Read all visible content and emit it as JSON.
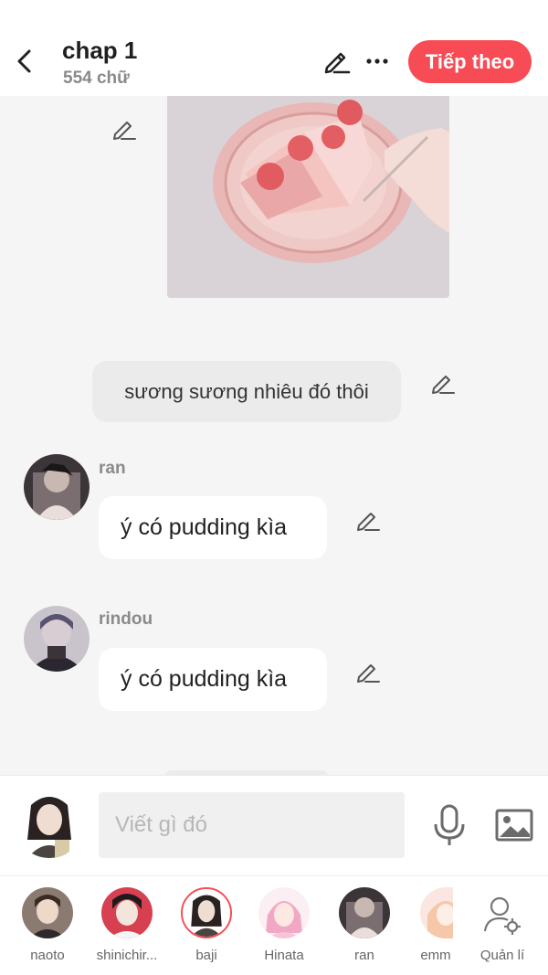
{
  "header": {
    "title": "chap 1",
    "word_count": "554 chữ",
    "next_label": "Tiếp theo"
  },
  "messages": [
    {
      "type": "image",
      "alt_icon": "strawberry-cake-photo"
    },
    {
      "type": "narration",
      "text": "sương sương nhiêu đó thôi"
    },
    {
      "type": "character",
      "name": "ran",
      "text": "ý có pudding kìa"
    },
    {
      "type": "character",
      "name": "rindou",
      "text": "ý có pudding kìa"
    }
  ],
  "input": {
    "placeholder": "Viết gì đó"
  },
  "characters": [
    {
      "label": "naoto"
    },
    {
      "label": "shinichir..."
    },
    {
      "label": "baji",
      "selected": true
    },
    {
      "label": "Hinata"
    },
    {
      "label": "ran"
    },
    {
      "label": "emm"
    }
  ],
  "manage_label": "Quản lí",
  "colors": {
    "accent": "#f74b55",
    "background": "#f5f5f5",
    "narration_bubble": "#ebebeb"
  }
}
